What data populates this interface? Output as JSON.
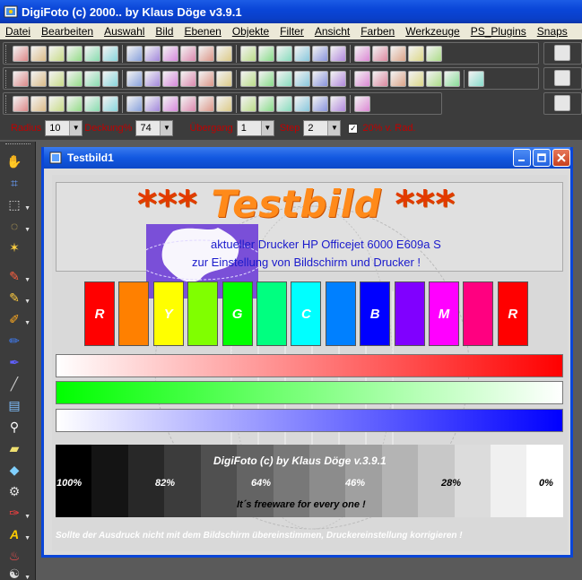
{
  "app": {
    "title": "DigiFoto (c) 2000.. by Klaus Döge v3.9.1"
  },
  "menu": {
    "items": [
      "Datei",
      "Bearbeiten",
      "Auswahl",
      "Bild",
      "Ebenen",
      "Objekte",
      "Filter",
      "Ansicht",
      "Farben",
      "Werkzeuge",
      "PS_Plugins",
      "Snaps"
    ]
  },
  "params": {
    "radius_label": "Radius",
    "radius_value": "10",
    "deckung_label": "Deckung%",
    "deckung_value": "74",
    "uebergang_label": "Übergang",
    "uebergang_value": "1",
    "step_label": "Step",
    "step_value": "2",
    "checkbox_label": "20% v. Rad.",
    "checkbox_checked": "✓"
  },
  "child_window": {
    "title": "Testbild1"
  },
  "testbild": {
    "headline_prefix": "*** ",
    "headline_word": "Testbild",
    "headline_suffix": " ***",
    "line1": "aktueller Drucker HP Officejet 6000 E609a S",
    "line2": "zur Einstellung von Bildschirm und Drucker !",
    "color_boxes": [
      {
        "label": "R",
        "color": "#ff0000"
      },
      {
        "label": "",
        "color": "#ff8000"
      },
      {
        "label": "Y",
        "color": "#ffff00"
      },
      {
        "label": "",
        "color": "#80ff00"
      },
      {
        "label": "G",
        "color": "#00ff00"
      },
      {
        "label": "",
        "color": "#00ff80"
      },
      {
        "label": "C",
        "color": "#00ffff"
      },
      {
        "label": "",
        "color": "#0080ff"
      },
      {
        "label": "B",
        "color": "#0000ff"
      },
      {
        "label": "",
        "color": "#8000ff"
      },
      {
        "label": "M",
        "color": "#ff00ff"
      },
      {
        "label": "",
        "color": "#ff0080"
      },
      {
        "label": "R",
        "color": "#ff0000"
      }
    ],
    "gradients": {
      "red": "#ff0000",
      "green": "#00ff00",
      "blue": "#0000ff"
    },
    "gray_values": [
      "#000000",
      "#141414",
      "#282828",
      "#3c3c3c",
      "#505050",
      "#646464",
      "#787878",
      "#8c8c8c",
      "#a0a0a0",
      "#b4b4b4",
      "#c8c8c8",
      "#dcdcdc",
      "#f0f0f0",
      "#ffffff"
    ],
    "credits": "DigiFoto (c) by Klaus Döge v.3.9.1",
    "percent_labels": [
      "100%",
      "82%",
      "64%",
      "46%",
      "28%",
      "0%"
    ],
    "freeware": "It´s freeware for every one !",
    "footer": "Sollte der Ausdruck nicht mit dem Bildschirm übereinstimmen, Druckereinstellung korrigieren !"
  },
  "icons": {
    "toolbar_row1": [
      "image-open-icon",
      "folder-open-icon",
      "grid-icon",
      "brush-icon",
      "film-icon",
      "page-icon",
      "folder-icon",
      "folder-new-icon",
      "copy-icon",
      "print-icon",
      "wand-icon",
      "tools-icon",
      "pen-icon",
      "palette-icon",
      "scissors-icon",
      "paint-icon",
      "filter-icon",
      "filter2-icon",
      "filter3-icon",
      "play-icon",
      "square-icon",
      "frame-icon",
      "settings-icon"
    ],
    "toolbar_row2": [
      "palette-icon",
      "swatch-icon",
      "swatch2-icon",
      "mask-icon",
      "stop-icon",
      "abc-icon",
      "film-icon",
      "film2-icon",
      "image-icon",
      "image2-icon",
      "pencil-icon",
      "gradient-icon",
      "image3-icon",
      "text-icon",
      "plus-icon",
      "eye-icon",
      "eye2-icon",
      "eye3-icon",
      "eye4-icon",
      "eye5-icon",
      "eye6-icon",
      "image4-icon",
      "image5-icon",
      "square2-icon",
      "square3-icon"
    ],
    "toolbar_row3": [
      "undo-icon",
      "redo-icon",
      "copy-icon",
      "copy2-icon",
      "cut-icon",
      "paste-icon",
      "image-icon",
      "image2-icon",
      "flip-h-icon",
      "flip-v-icon",
      "move-icon",
      "rotate-icon",
      "refresh-icon",
      "film-icon",
      "globe-icon",
      "jpg-icon",
      "bmp-icon",
      "spray-icon",
      "color-icon"
    ]
  }
}
